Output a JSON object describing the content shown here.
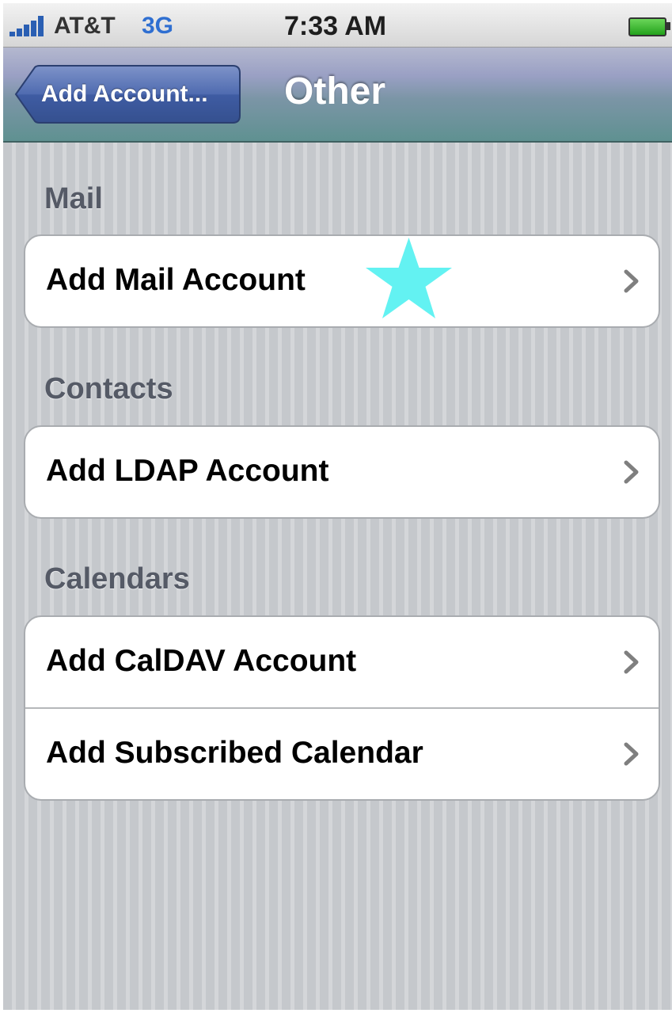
{
  "status_bar": {
    "carrier": "AT&T",
    "network": "3G",
    "time": "7:33 AM",
    "signal_icon": "signal-bars-icon",
    "battery_icon": "battery-icon"
  },
  "nav_bar": {
    "back_label": "Add Account...",
    "title": "Other"
  },
  "sections": [
    {
      "header": "Mail",
      "rows": [
        {
          "label": "Add Mail Account"
        }
      ]
    },
    {
      "header": "Contacts",
      "rows": [
        {
          "label": "Add LDAP Account"
        }
      ]
    },
    {
      "header": "Calendars",
      "rows": [
        {
          "label": "Add CalDAV Account"
        },
        {
          "label": "Add Subscribed Calendar"
        }
      ]
    }
  ],
  "annotation": {
    "icon": "star-icon",
    "color": "#63f2f2"
  },
  "colors": {
    "section_header": "#555a66",
    "nav_bar": "#6f949b",
    "network": "#2f6fd1",
    "battery": "#23a11b"
  }
}
